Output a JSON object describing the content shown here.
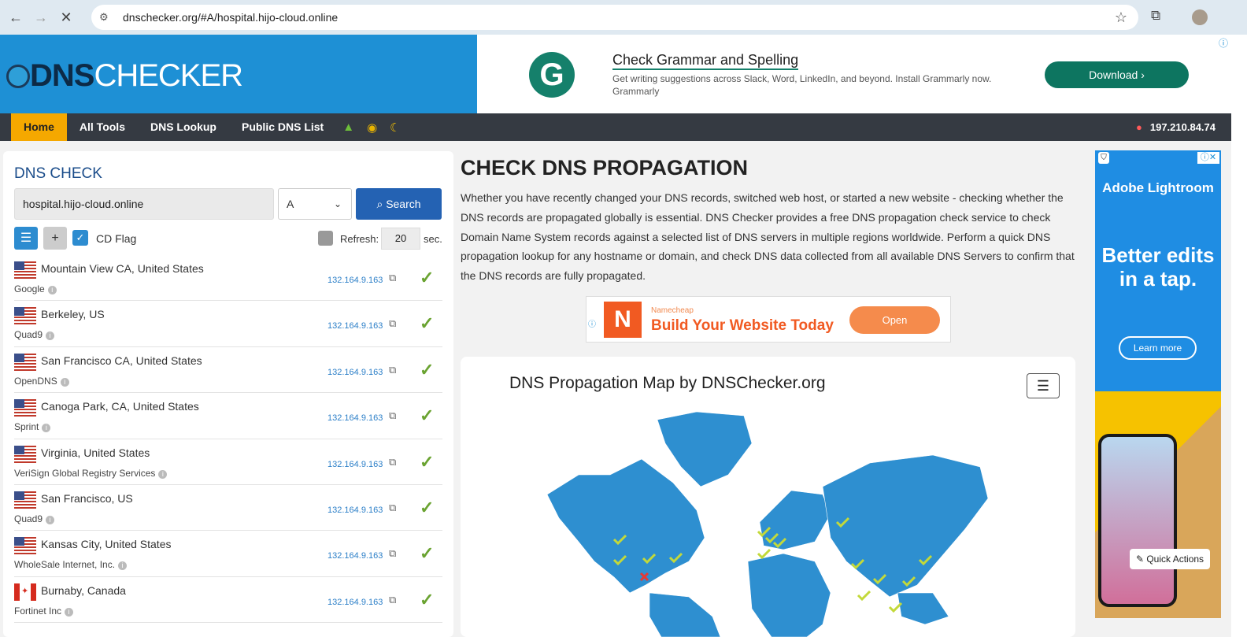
{
  "browser": {
    "url": "dnschecker.org/#A/hospital.hijo-cloud.online"
  },
  "logo": {
    "part1": "DNS",
    "part2": "CHECKER"
  },
  "ad_top": {
    "logo_letter": "G",
    "title": "Check Grammar and Spelling",
    "text": "Get writing suggestions across Slack, Word, LinkedIn, and beyond. Install Grammarly now. Grammarly",
    "button": "Download"
  },
  "nav": {
    "items": [
      "Home",
      "All Tools",
      "DNS Lookup",
      "Public DNS List"
    ],
    "ip": "197.210.84.74"
  },
  "dns_check": {
    "title": "DNS CHECK",
    "domain": "hospital.hijo-cloud.online",
    "record_type": "A",
    "search_label": "Search",
    "cd_flag_label": "CD Flag",
    "refresh_label": "Refresh:",
    "refresh_value": "20",
    "refresh_unit": "sec."
  },
  "results": [
    {
      "location": "Mountain View CA, United States",
      "provider": "Google",
      "ip": "132.164.9.163",
      "flag": "us"
    },
    {
      "location": "Berkeley, US",
      "provider": "Quad9",
      "ip": "132.164.9.163",
      "flag": "us"
    },
    {
      "location": "San Francisco CA, United States",
      "provider": "OpenDNS",
      "ip": "132.164.9.163",
      "flag": "us"
    },
    {
      "location": "Canoga Park, CA, United States",
      "provider": "Sprint",
      "ip": "132.164.9.163",
      "flag": "us"
    },
    {
      "location": "Virginia, United States",
      "provider": "VeriSign Global Registry Services",
      "ip": "132.164.9.163",
      "flag": "us"
    },
    {
      "location": "San Francisco, US",
      "provider": "Quad9",
      "ip": "132.164.9.163",
      "flag": "us"
    },
    {
      "location": "Kansas City, United States",
      "provider": "WholeSale Internet, Inc.",
      "ip": "132.164.9.163",
      "flag": "us"
    },
    {
      "location": "Burnaby, Canada",
      "provider": "Fortinet Inc",
      "ip": "132.164.9.163",
      "flag": "ca"
    }
  ],
  "main": {
    "title": "CHECK DNS PROPAGATION",
    "description": "Whether you have recently changed your DNS records, switched web host, or started a new website - checking whether the DNS records are propagated globally is essential. DNS Checker provides a free DNS propagation check service to check Domain Name System records against a selected list of DNS servers in multiple regions worldwide. Perform a quick DNS propagation lookup for any hostname or domain, and check DNS data collected from all available DNS Servers to confirm that the DNS records are fully propagated."
  },
  "ad_middle": {
    "brand": "Namecheap",
    "headline": "Build Your Website Today",
    "button": "Open"
  },
  "map": {
    "title": "DNS Propagation Map by DNSChecker.org"
  },
  "ad_side": {
    "brand": "Adobe Lightroom",
    "slogan": "Better edits in a tap.",
    "button": "Learn more",
    "quick_actions": "Quick Actions"
  },
  "colors": {
    "brand_blue": "#1e90d5",
    "nav_dark": "#353a42",
    "nav_active": "#f5a800",
    "success": "#6aa331",
    "map_land": "#2e8fd0"
  }
}
